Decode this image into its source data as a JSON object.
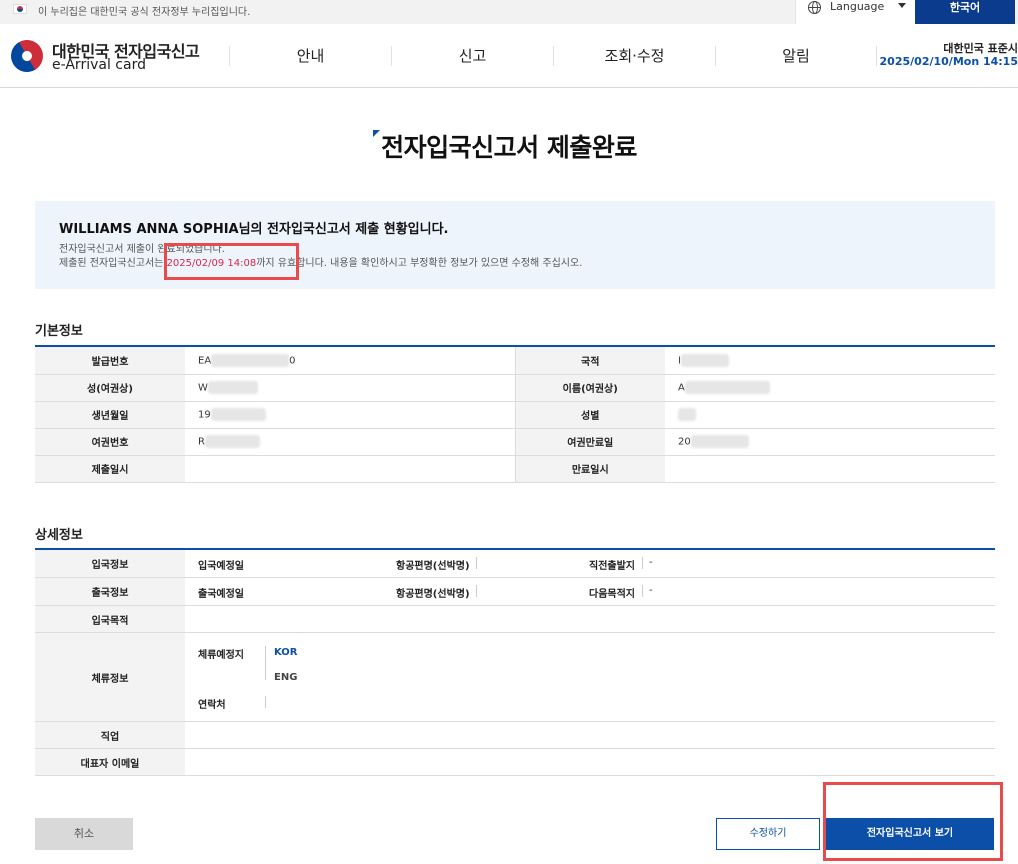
{
  "govbar": {
    "text": "이 누리집은 대한민국 공식 전자정부 누리집입니다.",
    "language_label": "Language",
    "korean_button": "한국어"
  },
  "header": {
    "logo_title": "대한민국 전자입국신고",
    "logo_sub": "e-Arrival card",
    "menu": [
      "안내",
      "신고",
      "조회·수정",
      "알림"
    ],
    "std_time_label": "대한민국 표준시",
    "std_time_value": "2025/02/10/Mon 14:15"
  },
  "page": {
    "title": "전자입국신고서 제출완료"
  },
  "notice": {
    "title": "WILLIAMS ANNA SOPHIA님의 전자입국신고서 제출 현황입니다.",
    "line1": "전자입국신고서 제출이 완료되었습니다.",
    "line2_prefix": "제출된 전자입국신고서는 ",
    "line2_date": "2025/02/09 14:08",
    "line2_suffix": "까지 유효합니다. 내용을 확인하시고 부정확한 정보가 있으면 수정해 주십시오."
  },
  "basic": {
    "title": "기본정보",
    "rows": [
      {
        "l1": "발급번호",
        "v1": "EA",
        "v1_tail": "0",
        "l2": "국적",
        "v2": "I"
      },
      {
        "l1": "성(여권상)",
        "v1": "W",
        "l2": "이름(여권상)",
        "v2": "A"
      },
      {
        "l1": "생년월일",
        "v1": "19",
        "l2": "성별",
        "v2": ""
      },
      {
        "l1": "여권번호",
        "v1": "R",
        "l2": "여권만료일",
        "v2": "20"
      },
      {
        "l1": "제출일시",
        "v1": "",
        "l2": "만료일시",
        "v2": ""
      }
    ]
  },
  "detail": {
    "title": "상세정보",
    "entry_label": "입국정보",
    "entry_date_label": "입국예정일",
    "entry_flight_label": "항공편명(선박명)",
    "entry_prev_label": "직전출발지",
    "entry_prev_value": "-",
    "exit_label": "출국정보",
    "exit_date_label": "출국예정일",
    "exit_flight_label": "항공편명(선박명)",
    "exit_next_label": "다음목적지",
    "exit_next_value": "-",
    "purpose_label": "입국목적",
    "stay_label": "체류정보",
    "stay_place_label": "체류예정지",
    "stay_kor": "KOR",
    "stay_eng": "ENG",
    "contact_label": "연락처",
    "job_label": "직업",
    "email_label": "대표자 이메일"
  },
  "buttons": {
    "cancel": "취소",
    "edit": "수정하기",
    "view": "전자입국신고서 보기"
  },
  "colors": {
    "primary": "#0b4fa8",
    "highlight_red": "#e84b4b",
    "date_red": "#d6284a"
  }
}
